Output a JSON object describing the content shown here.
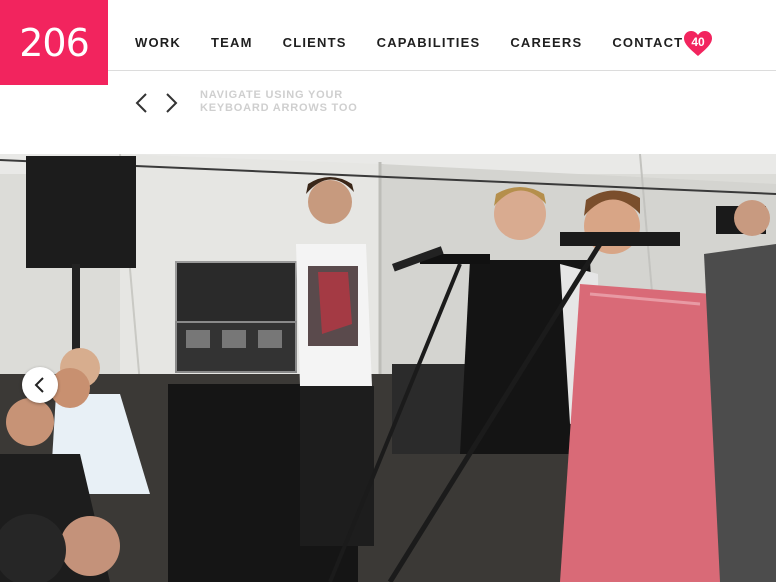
{
  "logo": {
    "text": "206",
    "color": "#f2245e"
  },
  "nav": {
    "items": [
      {
        "label": "WORK"
      },
      {
        "label": "TEAM"
      },
      {
        "label": "CLIENTS"
      },
      {
        "label": "CAPABILITIES"
      },
      {
        "label": "CAREERS"
      },
      {
        "label": "CONTACT"
      }
    ]
  },
  "favorites": {
    "count": "40",
    "icon": "heart-icon",
    "color": "#f2245e"
  },
  "gallery": {
    "hint_line1": "NAVIGATE USING YOUR",
    "hint_line2": "KEYBOARD ARROWS TOO",
    "prev_icon": "chevron-left-icon",
    "next_icon": "chevron-right-icon",
    "slide_prev_icon": "chevron-left-icon"
  }
}
